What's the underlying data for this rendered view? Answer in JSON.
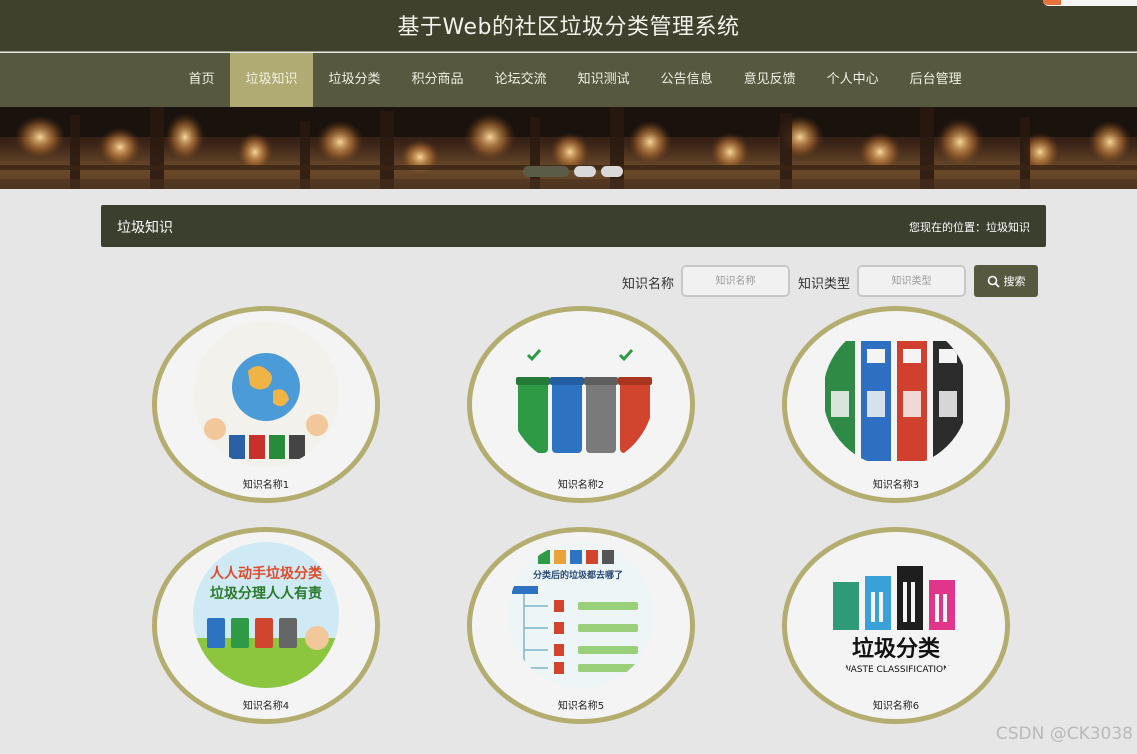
{
  "header": {
    "title": "基于Web的社区垃圾分类管理系统"
  },
  "nav": {
    "items": [
      "首页",
      "垃圾知识",
      "垃圾分类",
      "积分商品",
      "论坛交流",
      "知识测试",
      "公告信息",
      "意见反馈",
      "个人中心",
      "后台管理"
    ],
    "active_index": 1
  },
  "banner": {
    "slide_count": 3,
    "active_slide": 0
  },
  "section": {
    "title": "垃圾知识",
    "breadcrumb": "您现在的位置：垃圾知识"
  },
  "search": {
    "name_label": "知识名称",
    "name_placeholder": "知识名称",
    "type_label": "知识类型",
    "type_placeholder": "知识类型",
    "button_label": "搜索"
  },
  "cards": [
    {
      "caption": "知识名称1",
      "image": "globe-bins-illustration"
    },
    {
      "caption": "知识名称2",
      "image": "four-color-bins"
    },
    {
      "caption": "知识名称3",
      "image": "bin-lids-closeup"
    },
    {
      "caption": "知识名称4",
      "image": "poster",
      "poster_text": [
        "人人动手垃圾分类",
        "垃圾分理人人有责"
      ]
    },
    {
      "caption": "知识名称5",
      "image": "flow-chart",
      "chart_text": "分类后的垃圾都去哪了"
    },
    {
      "caption": "知识名称6",
      "image": "logo",
      "logo_text": "垃圾分类",
      "logo_subtext": "WASTE CLASSIFICATION"
    }
  ],
  "watermark": "CSDN @CK3038",
  "colors": {
    "header": "#3f412d",
    "nav": "#56583f",
    "active": "#b0ab72",
    "ring": "#b3ad70"
  }
}
